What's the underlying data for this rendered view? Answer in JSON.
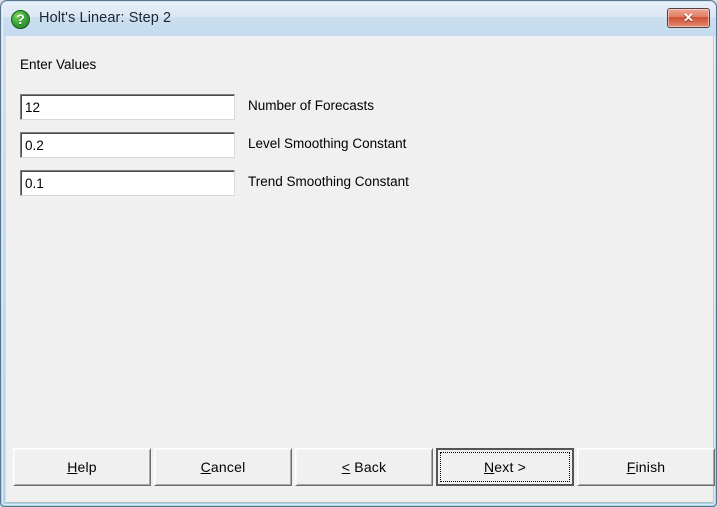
{
  "window": {
    "title": "Holt's Linear: Step 2",
    "icon": "green-question-mark-icon",
    "close_glyph": "✕",
    "titlebar_color": "#dbe7f4",
    "body_color": "#f0f0f0",
    "frame_color": "#a9d6ef"
  },
  "body": {
    "section_label": "Enter Values",
    "fields": [
      {
        "value": "12",
        "placeholder": "",
        "caption": "Number of Forecasts",
        "name": "number-of-forecasts"
      },
      {
        "value": "0.2",
        "placeholder": "",
        "caption": "Level Smoothing Constant",
        "name": "level-smoothing-constant"
      },
      {
        "value": "0.1",
        "placeholder": "",
        "caption": "Trend Smoothing Constant",
        "name": "trend-smoothing-constant"
      }
    ]
  },
  "buttons": [
    {
      "name": "help",
      "accel": "H",
      "before": "",
      "after": "elp",
      "full": "Help"
    },
    {
      "name": "cancel",
      "accel": "C",
      "before": "",
      "after": "ancel",
      "full": "Cancel"
    },
    {
      "name": "back",
      "accel": "<",
      "before": "",
      "after": " Back",
      "full": "< Back"
    },
    {
      "name": "next",
      "accel": "N",
      "before": "",
      "after": "ext >",
      "full": "Next >",
      "default": true
    },
    {
      "name": "finish",
      "accel": "F",
      "before": "",
      "after": "inish",
      "full": "Finish"
    }
  ]
}
